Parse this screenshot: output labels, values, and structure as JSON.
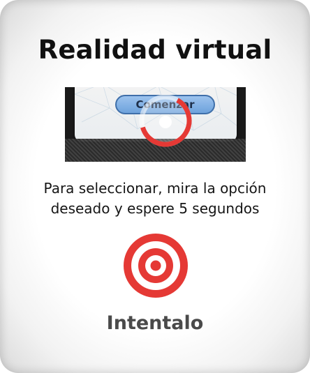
{
  "title": "Realidad virtual",
  "preview": {
    "button_label": "Comenzar",
    "gaze_progress": 0.62
  },
  "instructions": {
    "line1": "Para seleccionar, mira la opción",
    "line2": "deseado y espere 5 segundos"
  },
  "action": {
    "label": "Intentalo",
    "icon": "target-icon"
  },
  "colors": {
    "accent": "#e53935",
    "text": "#111111",
    "muted": "#4a4a4a"
  }
}
